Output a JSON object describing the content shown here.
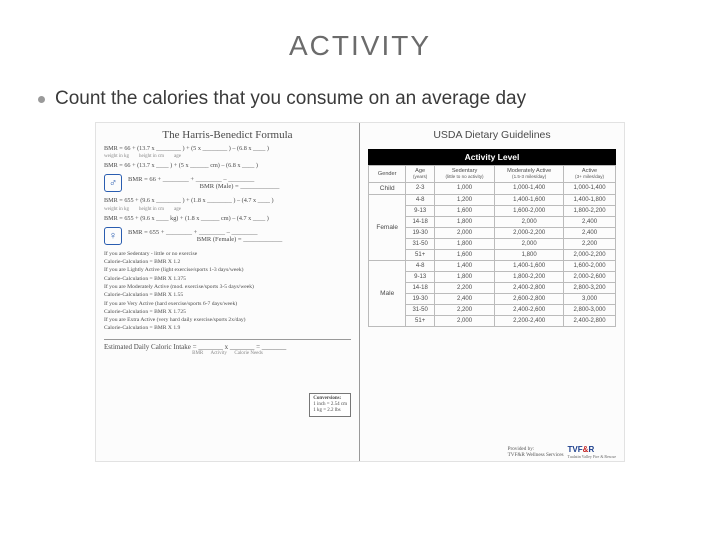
{
  "title": "ACTIVITY",
  "bullet": "Count the calories that you consume on an average day",
  "left": {
    "heading": "The Harris-Benedict Formula",
    "male_formula1": "BMR = 66 + (13.7 x ________ ) + (5 x ________ ) – (6.8 x ____ )",
    "male_sub": "weight in kg        height in cm        age",
    "male_formula2": "BMR = 66 + (13.7 x ____ ) + (5 x ______ cm) – (6.8 x ____ )",
    "male_calc": "BMR = 66 + ________ + ________ – ________",
    "male_result": "BMR (Male) = ____________",
    "female_formula1": "BMR = 655 + (9.6 x ________ ) + (1.8 x ________ ) – (4.7 x ____ )",
    "female_sub": "weight in kg        height in cm        age",
    "female_formula2": "BMR = 655 + (9.6 x ____ kg) + (1.8 x ______ cm) – (4.7 x ____ )",
    "female_calc": "BMR = 655 + ________ + ________ – ________",
    "female_result": "BMR (Female) = ____________",
    "notes": [
      "If you are Sedentary - little or no exercise",
      "Calorie-Calculation = BMR X 1.2",
      "If you are Lightly Active (light exercise/sports 1-3 days/week)",
      "Calorie-Calculation = BMR X 1.375",
      "If you are Moderately Active (mod. exercise/sports 3-5 days/week)",
      "Calorie-Calculation = BMR X 1.55",
      "If you are Very Active (hard exercise/sports 6-7 days/week)",
      "Calorie-Calculation = BMR X 1.725",
      "If you are Extra Active (very hard daily exercise/sports 2x/day)",
      "Calorie-Calculation = BMR X 1.9"
    ],
    "conv_title": "Conversions:",
    "conv1": "1 inch = 2.54 cm",
    "conv2": "1 kg = 2.2 lbs",
    "est": "Estimated Daily Caloric Intake = _______ x _______ = _______",
    "est_sub": "BMR      Activity      Calorie Needs"
  },
  "right": {
    "heading": "USDA Dietary Guidelines",
    "bar": "Activity Level",
    "headers": {
      "gender": "Gender",
      "age": "Age",
      "age_sub": "(years)",
      "sed": "Sedentary",
      "sed_sub": "(little to no activity)",
      "mod": "Moderately Active",
      "mod_sub": "(1.5-3 miles/day)",
      "act": "Active",
      "act_sub": "(3+ miles/day)"
    },
    "rows": [
      {
        "g": "Child",
        "age": "2-3",
        "s": "1,000",
        "m": "1,000-1,400",
        "a": "1,000-1,400"
      },
      {
        "g": "Female",
        "ages": [
          {
            "age": "4-8",
            "s": "1,200",
            "m": "1,400-1,600",
            "a": "1,400-1,800"
          },
          {
            "age": "9-13",
            "s": "1,600",
            "m": "1,600-2,000",
            "a": "1,800-2,200"
          },
          {
            "age": "14-18",
            "s": "1,800",
            "m": "2,000",
            "a": "2,400"
          },
          {
            "age": "19-30",
            "s": "2,000",
            "m": "2,000-2,200",
            "a": "2,400"
          },
          {
            "age": "31-50",
            "s": "1,800",
            "m": "2,000",
            "a": "2,200"
          },
          {
            "age": "51+",
            "s": "1,600",
            "m": "1,800",
            "a": "2,000-2,200"
          }
        ]
      },
      {
        "g": "Male",
        "ages": [
          {
            "age": "4-8",
            "s": "1,400",
            "m": "1,400-1,600",
            "a": "1,600-2,000"
          },
          {
            "age": "9-13",
            "s": "1,800",
            "m": "1,800-2,200",
            "a": "2,000-2,600"
          },
          {
            "age": "14-18",
            "s": "2,200",
            "m": "2,400-2,800",
            "a": "2,800-3,200"
          },
          {
            "age": "19-30",
            "s": "2,400",
            "m": "2,600-2,800",
            "a": "3,000"
          },
          {
            "age": "31-50",
            "s": "2,200",
            "m": "2,400-2,600",
            "a": "2,800-3,000"
          },
          {
            "age": "51+",
            "s": "2,000",
            "m": "2,200-2,400",
            "a": "2,400-2,800"
          }
        ]
      }
    ],
    "provided": "Provided by:",
    "provided2": "TVF&R Wellness Services",
    "logo": {
      "t": "TVF",
      "amp": "&",
      "r": "R",
      "sub": "Tualatin Valley Fire & Rescue"
    }
  }
}
